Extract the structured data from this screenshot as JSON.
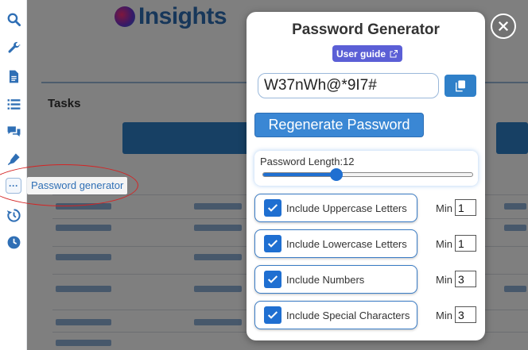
{
  "background": {
    "logo_text": "Insights",
    "section_title": "Tasks"
  },
  "sidebar": {
    "tooltip": "Password generator"
  },
  "modal": {
    "title": "Password Generator",
    "user_guide_label": "User guide",
    "password_value": "W37nWh@*9I7#",
    "regenerate_label": "Regenerate Password",
    "length_label": "Password Length:12",
    "length_fraction": 0.35,
    "min_label": "Min",
    "options": [
      {
        "label": "Include Uppercase Letters",
        "checked": true,
        "min": "1"
      },
      {
        "label": "Include Lowercase Letters",
        "checked": true,
        "min": "1"
      },
      {
        "label": "Include Numbers",
        "checked": true,
        "min": "3"
      },
      {
        "label": "Include Special Characters",
        "checked": true,
        "min": "3"
      }
    ]
  },
  "colors": {
    "accent": "#2f80c9",
    "checkbox": "#1f6fd1",
    "guide_button": "#5b5fd6",
    "annotation": "#d42424"
  }
}
